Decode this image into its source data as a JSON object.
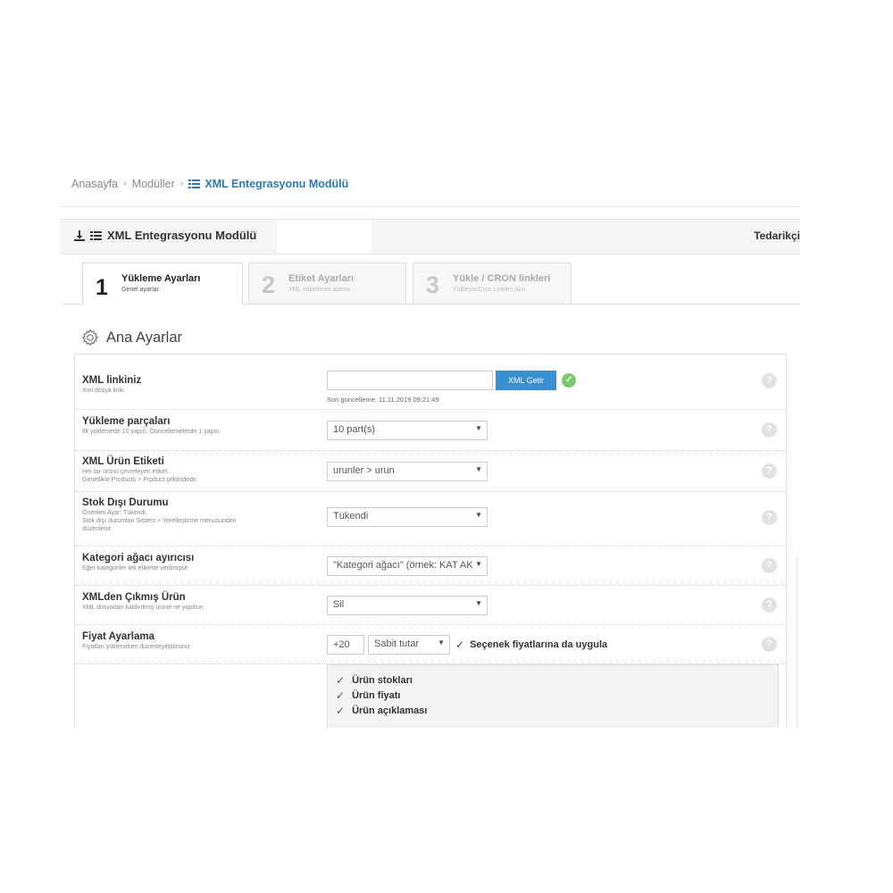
{
  "breadcrumb": {
    "home": "Anasayfa",
    "modules": "Modüller",
    "current": "XML Entegrasyonu Modülü"
  },
  "panel": {
    "title": "XML Entegrasyonu Modülü",
    "right_label": "Tedarikçi"
  },
  "tabs": [
    {
      "num": "1",
      "title": "Yükleme Ayarları",
      "sub": "Genel ayarlar",
      "active": true
    },
    {
      "num": "2",
      "title": "Etiket Ayarları",
      "sub": "XML etiketlerini atama",
      "active": false
    },
    {
      "num": "3",
      "title": "Yükle / CRON linkleri",
      "sub": "Yükleyin/Cron Linkleri Alın",
      "active": false
    }
  ],
  "section": {
    "title": "Ana Ayarlar"
  },
  "settings": {
    "xml_link": {
      "label": "XML linkiniz",
      "desc": "Xml dosya linki",
      "value": "",
      "button": "XML Getir",
      "last_update": "Son güncelleme: 11.11.2019 09:21:49"
    },
    "parts": {
      "label": "Yükleme parçaları",
      "desc": "İlk yüklemede 10 yapın. Güncellemelerde 1 yapın.",
      "value": "10 part(s)"
    },
    "product_tag": {
      "label": "XML Ürün Etiketi",
      "desc1": "Her bir ürünü çevreleyen etiket.",
      "desc2": "Genellikle Products > Prpduct şeklindedir.",
      "value": "urunler > urun"
    },
    "stock": {
      "label": "Stok Dışı Durumu",
      "desc1": "Önerilen Ayar: Tükendi.",
      "desc2": "Stok dışı durumları Sistem > Yerelleştirme menusunden",
      "desc3": "düzenlenir.",
      "value": "Tükendi"
    },
    "category": {
      "label": "Kategori ağacı ayırıcısı",
      "desc": "Eğer kategoriler tek etikette verilmişse",
      "value": "\"Kategori ağacı\" (örnek: KAT AK"
    },
    "removed": {
      "label": "XMLden Çıkmış Ürün",
      "desc": "XML dosyadan kaldırılmış ürüne ne yapılsın",
      "value": "Sil"
    },
    "price": {
      "label": "Fiyat Ayarlama",
      "desc": "Fiyatları yüklenirken düzenleyebilirsiniz",
      "amount": "+20",
      "mode": "Sabit tutar",
      "apply_label": "Seçenek fiyatlarına da uygula"
    },
    "update_items": [
      "Ürün stokları",
      "Ürün fiyatı",
      "Ürün açıklaması"
    ]
  },
  "help_glyph": "?",
  "icons": {
    "download": "download-icon",
    "module": "list-icon",
    "settings": "gear-icon",
    "check": "check-icon"
  },
  "colors": {
    "accent": "#3a8fd0",
    "breadcrumb_current": "#2a7ab8",
    "ok": "#7cc86e"
  }
}
